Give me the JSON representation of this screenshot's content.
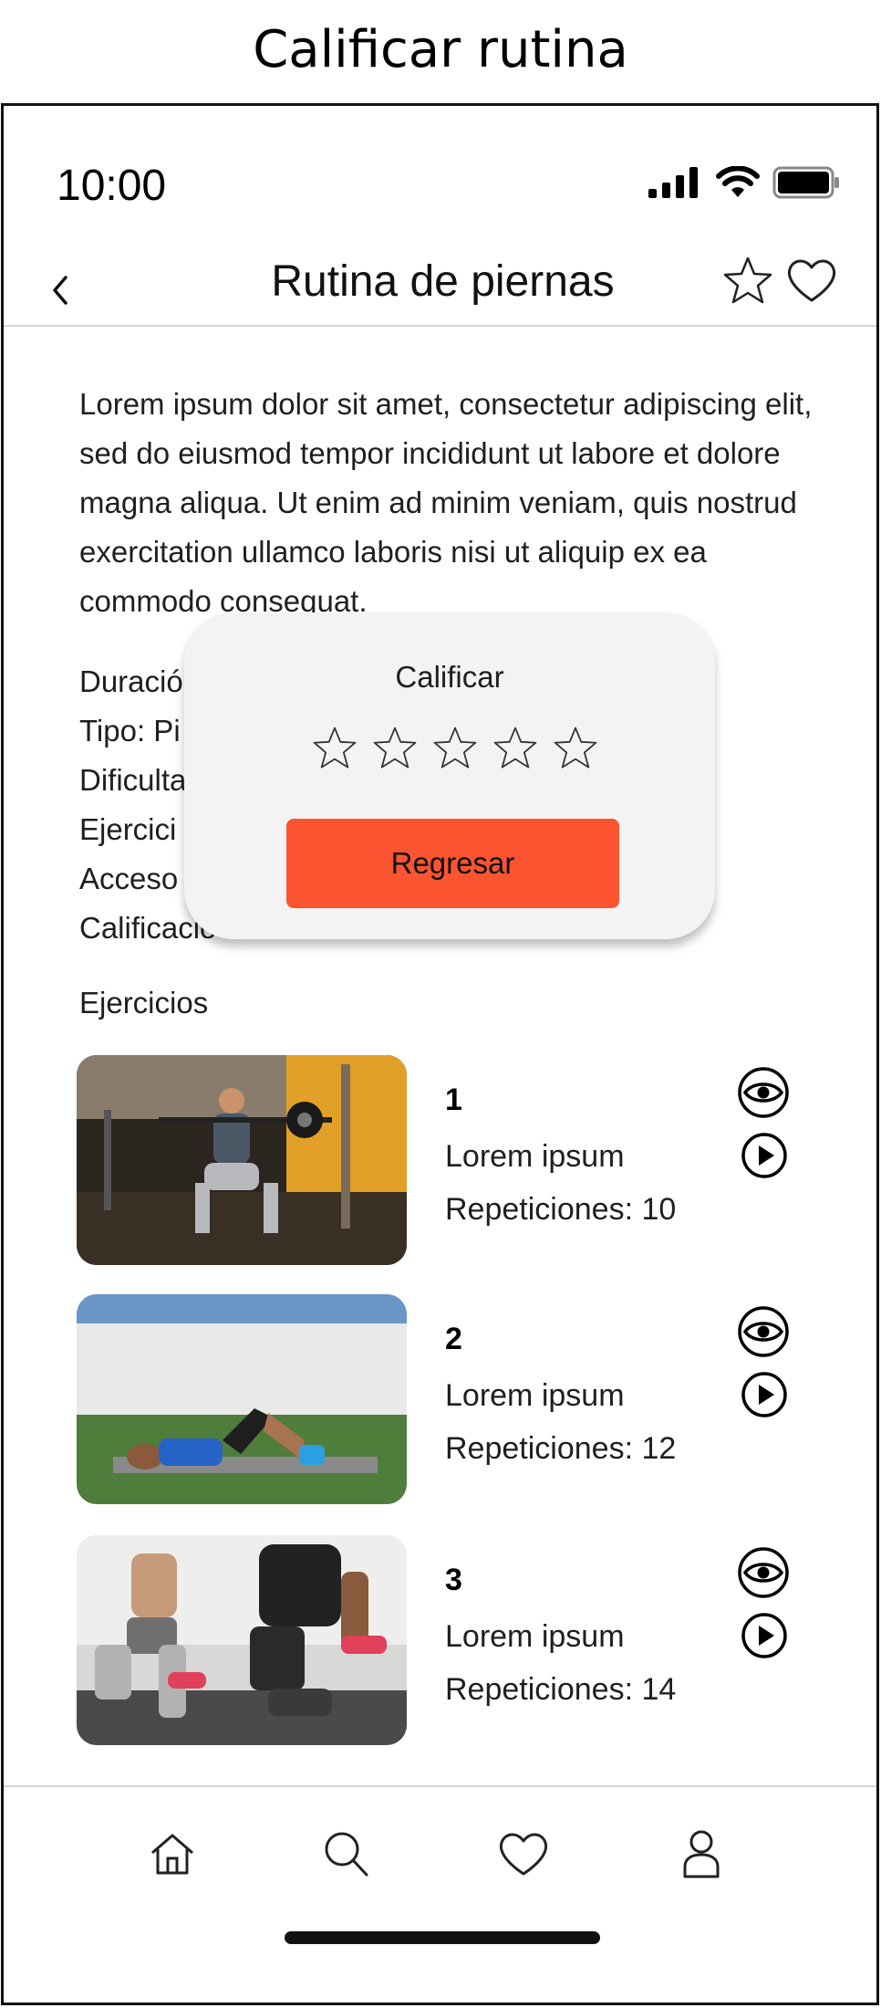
{
  "screen": {
    "label": "Calificar rutina"
  },
  "status_bar": {
    "time": "10:00"
  },
  "nav": {
    "title": "Rutina de piernas"
  },
  "description": "Lorem ipsum dolor sit amet, consectetur adipiscing elit, sed do eiusmod tempor incididunt ut labore et dolore magna aliqua. Ut enim ad minim veniam, quis nostrud exercitation ullamco laboris nisi ut aliquip ex ea commodo consequat.",
  "details": [
    {
      "label": "Duración"
    },
    {
      "label": "Tipo: Pi"
    },
    {
      "label": "Dificulta"
    },
    {
      "label": "Ejercici"
    },
    {
      "label": "Acceso"
    },
    {
      "label": "Calificacio"
    }
  ],
  "exercises_heading": "Ejercicios",
  "exercises": [
    {
      "number": "1",
      "name": "Lorem ipsum",
      "reps": "Repeticiones: 10"
    },
    {
      "number": "2",
      "name": "Lorem ipsum",
      "reps": "Repeticiones: 12"
    },
    {
      "number": "3",
      "name": "Lorem ipsum",
      "reps": "Repeticiones: 14"
    }
  ],
  "modal": {
    "title": "Calificar",
    "rating": 0,
    "max_rating": 5,
    "button_label": "Regresar",
    "button_color": "#fb5431"
  },
  "bottom_nav": [
    {
      "icon": "home-icon"
    },
    {
      "icon": "search-icon"
    },
    {
      "icon": "heart-icon"
    },
    {
      "icon": "profile-icon"
    }
  ]
}
